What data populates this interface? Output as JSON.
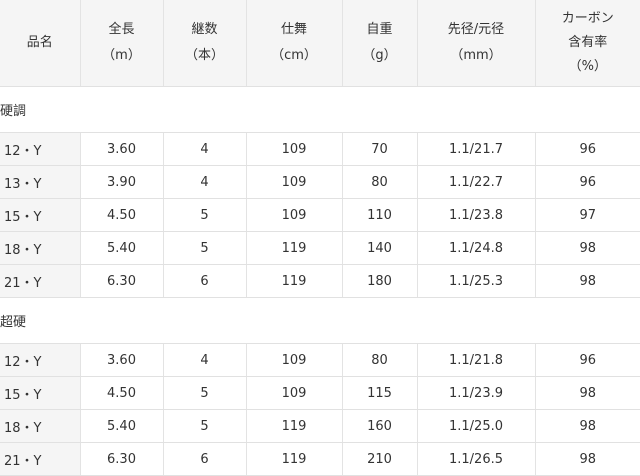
{
  "headers": [
    {
      "lines": [
        "品名"
      ]
    },
    {
      "lines": [
        "全長",
        "（m）"
      ]
    },
    {
      "lines": [
        "継数",
        "（本）"
      ]
    },
    {
      "lines": [
        "仕舞",
        "（cm）"
      ]
    },
    {
      "lines": [
        "自重",
        "（g）"
      ]
    },
    {
      "lines": [
        "先径/元径",
        "（mm）"
      ]
    },
    {
      "lines": [
        "カーボン",
        "含有率",
        "（%）"
      ]
    }
  ],
  "groups": [
    {
      "label": "硬調",
      "rows": [
        [
          "12・Y",
          "3.60",
          "4",
          "109",
          "70",
          "1.1/21.7",
          "96"
        ],
        [
          "13・Y",
          "3.90",
          "4",
          "109",
          "80",
          "1.1/22.7",
          "96"
        ],
        [
          "15・Y",
          "4.50",
          "5",
          "109",
          "110",
          "1.1/23.8",
          "97"
        ],
        [
          "18・Y",
          "5.40",
          "5",
          "119",
          "140",
          "1.1/24.8",
          "98"
        ],
        [
          "21・Y",
          "6.30",
          "6",
          "119",
          "180",
          "1.1/25.3",
          "98"
        ]
      ]
    },
    {
      "label": "超硬",
      "rows": [
        [
          "12・Y",
          "3.60",
          "4",
          "109",
          "80",
          "1.1/21.8",
          "96"
        ],
        [
          "15・Y",
          "4.50",
          "5",
          "109",
          "115",
          "1.1/23.9",
          "98"
        ],
        [
          "18・Y",
          "5.40",
          "5",
          "119",
          "160",
          "1.1/25.0",
          "98"
        ],
        [
          "21・Y",
          "6.30",
          "6",
          "119",
          "210",
          "1.1/26.5",
          "98"
        ]
      ]
    }
  ]
}
